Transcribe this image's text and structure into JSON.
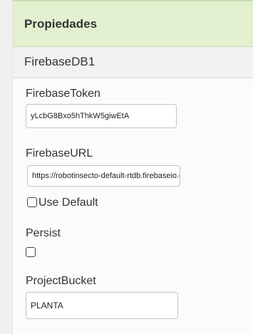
{
  "panel": {
    "title": "Propiedades",
    "component_name": "FirebaseDB1"
  },
  "properties": {
    "firebase_token": {
      "label": "FirebaseToken",
      "value": "yLcbG8Bxo5hThkW5giwEtA"
    },
    "firebase_url": {
      "label": "FirebaseURL",
      "value": "https://robotinsecto-default-rtdb.firebaseio.com/",
      "use_default_label": "Use Default",
      "use_default_checked": false
    },
    "persist": {
      "label": "Persist",
      "checked": false
    },
    "project_bucket": {
      "label": "ProjectBucket",
      "value": "PLANTA"
    }
  }
}
